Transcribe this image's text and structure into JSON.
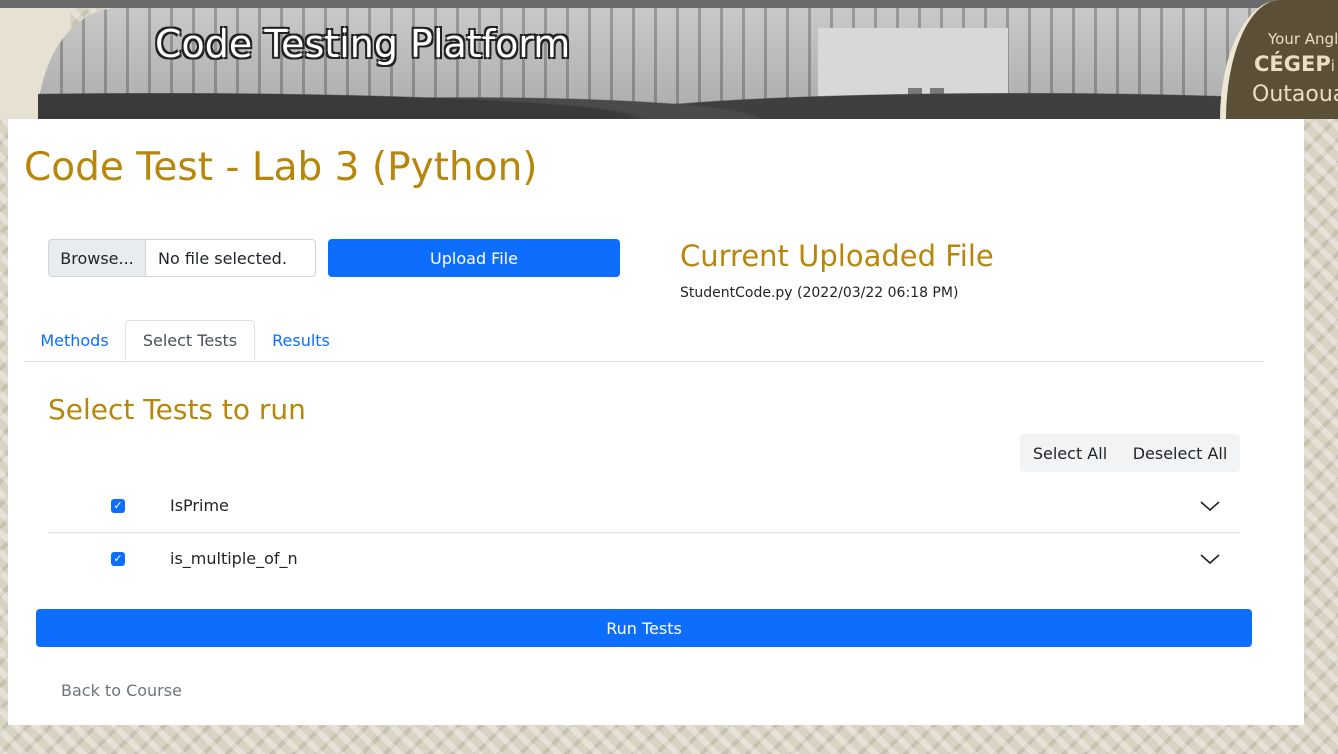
{
  "banner": {
    "title": "Code Testing Platform",
    "logo": {
      "line1": "Your Angl",
      "line2": "CÉGEP",
      "line2_suffix": "i",
      "line3": "Outaoua"
    }
  },
  "page": {
    "title": "Code Test - Lab 3 (Python)"
  },
  "upload": {
    "browse_label": "Browse...",
    "file_status": "No file selected.",
    "upload_label": "Upload File"
  },
  "current_file": {
    "heading": "Current Uploaded File",
    "info": "StudentCode.py (2022/03/22 06:18 PM)"
  },
  "tabs": [
    {
      "label": "Methods",
      "active": false
    },
    {
      "label": "Select Tests",
      "active": true
    },
    {
      "label": "Results",
      "active": false
    }
  ],
  "select_tests": {
    "heading": "Select Tests to run",
    "select_all": "Select All",
    "deselect_all": "Deselect All",
    "tests": [
      {
        "name": "IsPrime",
        "checked": true
      },
      {
        "name": "is_multiple_of_n",
        "checked": true
      }
    ],
    "run_label": "Run Tests"
  },
  "back_link": "Back to Course",
  "colors": {
    "accent": "#b8860b",
    "primary": "#0d6efd",
    "muted": "#6c757d"
  },
  "icons": {
    "checkbox": "checkmark-icon",
    "expand": "chevron-down-icon"
  }
}
